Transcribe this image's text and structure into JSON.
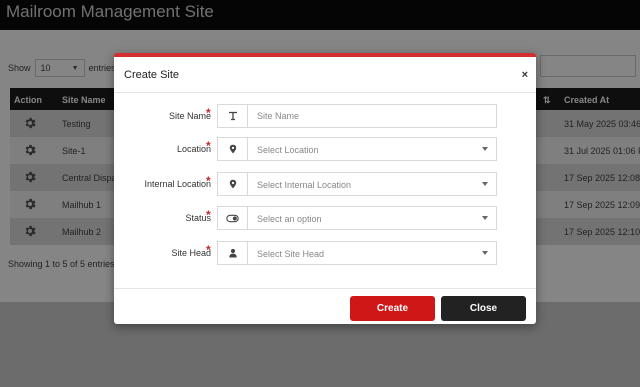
{
  "app": {
    "title": "Mailroom Management Site"
  },
  "list": {
    "show_label": "Show",
    "page_size": "10",
    "entries_label": "entries",
    "columns": {
      "action": "Action",
      "site_name": "Site Name",
      "created_at": "Created At"
    },
    "rows": [
      {
        "name": "Testing",
        "created": "31 May 2025 03:46"
      },
      {
        "name": "Site-1",
        "created": "31 Jul 2025 01:06 PI"
      },
      {
        "name": "Central Dispa",
        "created": "17 Sep 2025 12:08 I"
      },
      {
        "name": "Mailhub 1",
        "created": "17 Sep 2025 12:09 I"
      },
      {
        "name": "Mailhub 2",
        "created": "17 Sep 2025 12:10 I"
      }
    ],
    "info": "Showing 1 to 5 of 5 entries"
  },
  "modal": {
    "title": "Create Site",
    "close_glyph": "×",
    "fields": [
      {
        "label": "Site Name",
        "icon": "text-cursor-icon",
        "placeholder": "Site Name",
        "type": "text"
      },
      {
        "label": "Location",
        "icon": "map-pin-icon",
        "placeholder": "Select Location",
        "type": "select"
      },
      {
        "label": "Internal Location",
        "icon": "map-pin-icon",
        "placeholder": "Select Internal Location",
        "type": "select"
      },
      {
        "label": "Status",
        "icon": "toggle-icon",
        "placeholder": "Select an option",
        "type": "select"
      },
      {
        "label": "Site Head",
        "icon": "user-icon",
        "placeholder": "Select Site Head",
        "type": "select"
      }
    ],
    "create_label": "Create",
    "close_label": "Close"
  },
  "colors": {
    "accent": "#d01717",
    "dark_button": "#222222",
    "header_bar": "#0b0b0b"
  }
}
